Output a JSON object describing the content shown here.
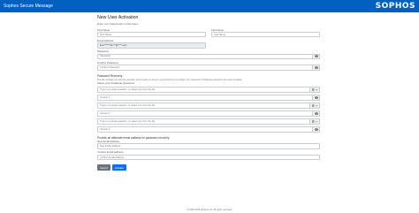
{
  "header": {
    "app_title": "Sophos Secure Message",
    "logo_text": "SOPHOS"
  },
  "page": {
    "title": "New User Activation",
    "subtitle": "Enter your Registration Information"
  },
  "form": {
    "first_name": {
      "label": "First Name",
      "placeholder": "First Name"
    },
    "last_name": {
      "label": "Last Name",
      "placeholder": "Last Name"
    },
    "email": {
      "label": "Email Address",
      "value": "kee*******4e***@****.com"
    },
    "password": {
      "label": "Password",
      "placeholder": "Password"
    },
    "confirm_password": {
      "label": "Confirm Password",
      "placeholder": "Confirm Password"
    },
    "recovery": {
      "heading": "Password Recovery",
      "note": "Provide at least one security question and answer to recover your account if you forget your password. Challenge questions are case-sensitive.",
      "select_label": "Select your Challenge Questions",
      "questions": [
        {
          "placeholder": "Type in a unique question, or select one from the list",
          "answer_placeholder": "Answer 1"
        },
        {
          "placeholder": "Type in a unique question, or select one from the list",
          "answer_placeholder": "Answer 2"
        },
        {
          "placeholder": "Type in a unique question, or select one from the list",
          "answer_placeholder": "Answer 3"
        }
      ]
    },
    "alt_email": {
      "heading": "Provide an alternate email address for password recovery",
      "new_label": "New Email Address",
      "new_placeholder": "New Email Address",
      "confirm_label": "Confirm Email Address",
      "confirm_placeholder": "Confirm Email Address"
    }
  },
  "actions": {
    "cancel": "Cancel",
    "activate": "Activate"
  },
  "footer": {
    "text": "© 1999-2024 Sophos Ltd. All rights reserved."
  },
  "colors": {
    "brand": "#0060c0",
    "primary": "#0d6efd",
    "secondary": "#6c757d"
  }
}
